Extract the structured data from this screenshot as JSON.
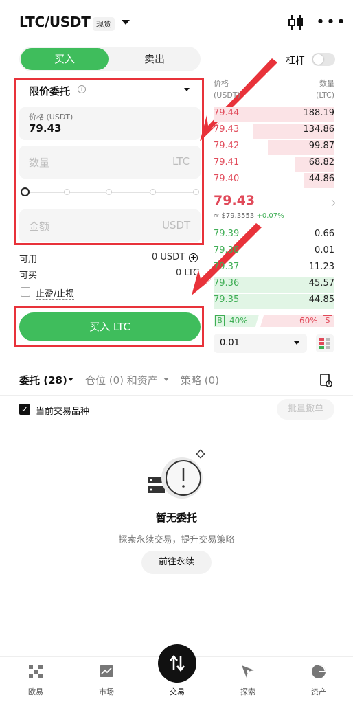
{
  "header": {
    "pair": "LTC/USDT",
    "market_tag": "现货"
  },
  "side_toggle": {
    "buy": "买入",
    "sell": "卖出"
  },
  "leverage": {
    "label": "杠杆",
    "enabled": false
  },
  "order_form": {
    "order_type": "限价委托",
    "price_label": "价格 (USDT)",
    "price_value": "79.43",
    "amount_placeholder": "数量",
    "amount_unit": "LTC",
    "total_placeholder": "金额",
    "total_unit": "USDT",
    "slider_percent": 0,
    "available_label": "可用",
    "available_value": "0 USDT",
    "max_buy_label": "可买",
    "max_buy_value": "0 LTC",
    "tp_sl_label": "止盈/止损",
    "submit_label": "买入 LTC"
  },
  "order_book": {
    "price_header": "价格",
    "price_unit": "(USDT)",
    "qty_header": "数量",
    "qty_unit": "(LTC)",
    "asks": [
      {
        "price": "79.44",
        "qty": "188.19",
        "depth": 1.0
      },
      {
        "price": "79.43",
        "qty": "134.86",
        "depth": 0.67
      },
      {
        "price": "79.42",
        "qty": "99.87",
        "depth": 0.55
      },
      {
        "price": "79.41",
        "qty": "68.82",
        "depth": 0.33
      },
      {
        "price": "79.40",
        "qty": "44.86",
        "depth": 0.25
      }
    ],
    "last_price": "79.43",
    "last_fiat": "≈ $79.3553",
    "last_change": "+0.07%",
    "bids": [
      {
        "price": "79.39",
        "qty": "0.66",
        "depth": 0.0
      },
      {
        "price": "79.38",
        "qty": "0.01",
        "depth": 0.0
      },
      {
        "price": "79.37",
        "qty": "11.23",
        "depth": 0.0
      },
      {
        "price": "79.36",
        "qty": "45.57",
        "depth": 1.0
      },
      {
        "price": "79.35",
        "qty": "44.85",
        "depth": 1.0
      }
    ],
    "buy_badge": "B",
    "buy_ratio": "40%",
    "sell_ratio": "60%",
    "sell_badge": "S",
    "depth_step": "0.01"
  },
  "tabs": {
    "orders": "委托 (28)",
    "positions": "仓位 (0) 和资产",
    "strategy": "策略 (0)"
  },
  "filter": {
    "current_pair_label": "当前交易品种",
    "current_pair_checked": true,
    "batch_cancel": "批量撤单"
  },
  "empty_state": {
    "title": "暂无委托",
    "subtitle": "探索永续交易，提升交易策略",
    "button": "前往永续"
  },
  "bottom_nav": [
    "欧易",
    "市场",
    "交易",
    "探索",
    "资产"
  ],
  "colors": {
    "accent_green": "#3fbd5c",
    "ask_red": "#e14a5a",
    "bid_green": "#3fae55",
    "highlight_red": "#e8323a"
  }
}
